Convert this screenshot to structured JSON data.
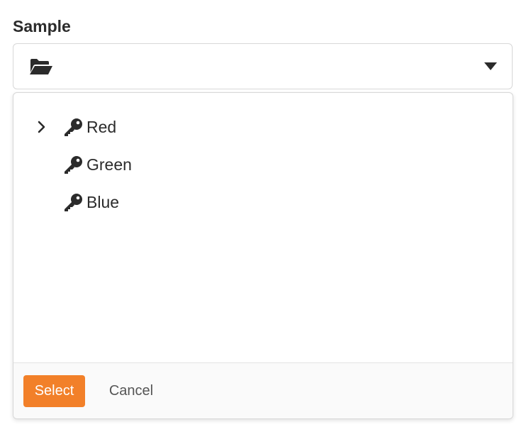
{
  "field": {
    "label": "Sample",
    "selected_icon": "folder-open-icon",
    "toggle_icon": "caret-down-icon"
  },
  "tree": {
    "items": [
      {
        "label": "Red",
        "icon": "key-icon",
        "expandable": true
      },
      {
        "label": "Green",
        "icon": "key-icon",
        "expandable": false
      },
      {
        "label": "Blue",
        "icon": "key-icon",
        "expandable": false
      }
    ]
  },
  "footer": {
    "select_label": "Select",
    "cancel_label": "Cancel"
  },
  "colors": {
    "accent": "#f28029",
    "text": "#2b2b2b",
    "border": "#d7d7d7",
    "footer_bg": "#fafafa"
  }
}
